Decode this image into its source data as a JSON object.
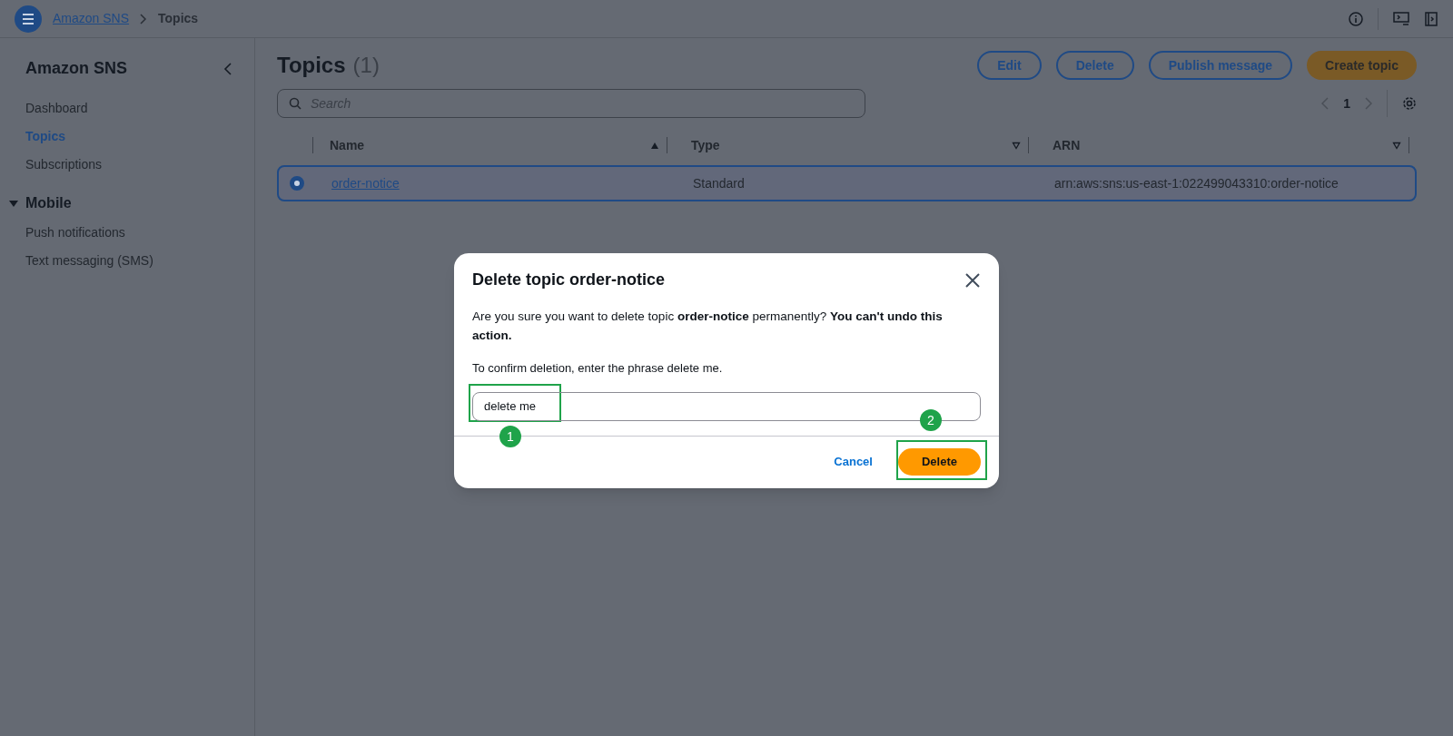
{
  "breadcrumbs": [
    {
      "label": "Amazon SNS",
      "kind": "link"
    },
    {
      "label": "Topics",
      "kind": "current"
    }
  ],
  "sidebar": {
    "title": "Amazon SNS",
    "items": [
      {
        "label": "Dashboard",
        "selected": false
      },
      {
        "label": "Topics",
        "selected": true
      },
      {
        "label": "Subscriptions",
        "selected": false
      }
    ],
    "groups": [
      {
        "label": "Mobile",
        "expanded": true,
        "items": [
          {
            "label": "Push notifications",
            "selected": false
          },
          {
            "label": "Text messaging (SMS)",
            "selected": false
          }
        ]
      }
    ]
  },
  "page": {
    "title": "Topics",
    "count": "(1)",
    "buttons": [
      {
        "label": "Edit",
        "kind": "normal"
      },
      {
        "label": "Delete",
        "kind": "normal"
      },
      {
        "label": "Publish message",
        "kind": "normal"
      },
      {
        "label": "Create topic",
        "kind": "primary"
      }
    ],
    "search": {
      "placeholder": "Search"
    },
    "pagination": {
      "page": "1"
    }
  },
  "table": {
    "columns": [
      {
        "label": "Name",
        "kind": "sorted"
      },
      {
        "label": "Type",
        "kind": "sortable"
      },
      {
        "label": "ARN",
        "kind": "sortable"
      }
    ],
    "rows": [
      {
        "selected": true,
        "name": "order-notice",
        "type": "Standard",
        "arn": "arn:aws:sns:us-east-1:022499043310:order-notice"
      }
    ]
  },
  "dialog": {
    "title": "Delete topic order-notice",
    "message": "Are you sure you want to delete topic **order-notice** permanently? **You can't undo this action.**",
    "instruction": "To confirm deletion, enter the phrase delete me.",
    "input_value": "delete me",
    "cancel": "Cancel",
    "confirm": "Delete"
  },
  "callouts": [
    {
      "number": "1",
      "kind": "field"
    },
    {
      "number": "2",
      "kind": "button"
    }
  ]
}
